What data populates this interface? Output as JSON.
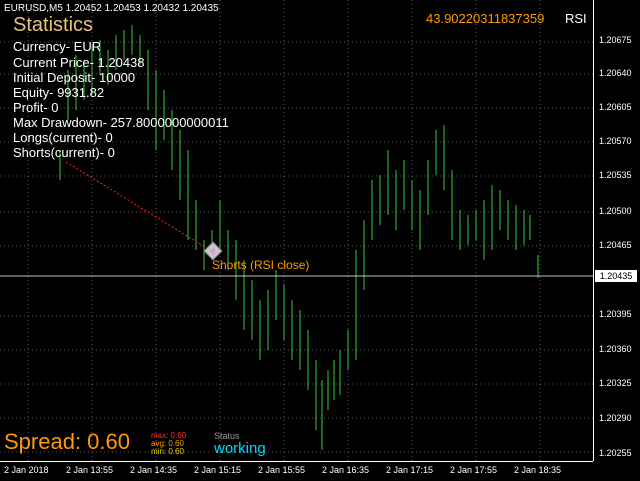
{
  "header": {
    "symbol_info": "EURUSD,M5  1.20452 1.20453 1.20432 1.20435"
  },
  "indicator": {
    "rsi_value": "43.90220311837359",
    "rsi_label": "RSI"
  },
  "statistics": {
    "title": "Statistics",
    "lines": [
      "Currency- EUR",
      "Current Price- 1.20438",
      "Initial Deposit- 10000",
      "Equity- 9931.82",
      "Profit- 0",
      "Max Drawdown- 257.8000000000011",
      "Longs(current)- 0",
      "Shorts(current)- 0"
    ]
  },
  "price_axis": {
    "labels": [
      "1.20675",
      "1.20640",
      "1.20605",
      "1.20570",
      "1.20535",
      "1.20500",
      "1.20465",
      "1.20395",
      "1.20360",
      "1.20325",
      "1.20290",
      "1.20255"
    ],
    "current_price": "1.20435"
  },
  "time_axis": {
    "labels": [
      "2 Jan 2018",
      "2 Jan 13:55",
      "2 Jan 14:35",
      "2 Jan 15:15",
      "2 Jan 15:55",
      "2 Jan 16:35",
      "2 Jan 17:15",
      "2 Jan 17:55",
      "2 Jan 18:35"
    ]
  },
  "trade_marker": {
    "label": "Shorts (RSI close)",
    "icon": "trade-arrow-icon"
  },
  "spread": {
    "label": "Spread: 0.60",
    "max": "max: 0.60",
    "avg": "avg: 0.60",
    "min": "min: 0.60"
  },
  "status": {
    "caption": "Status",
    "value": "working"
  },
  "colors": {
    "background": "#000000",
    "candle": "#32cd32",
    "accent": "#ff9a00",
    "status": "#00d8ff",
    "title": "#e6c27a"
  }
}
